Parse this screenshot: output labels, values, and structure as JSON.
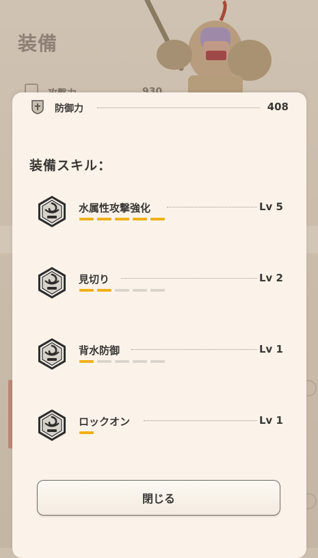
{
  "background": {
    "title": "装備",
    "stat_label": "攻撃力",
    "stat_value": "930"
  },
  "modal": {
    "defense": {
      "label": "防御力",
      "value": "408",
      "icon": "shield-icon"
    },
    "skills_heading": "装備スキル：",
    "skills": [
      {
        "name": "水属性攻撃強化",
        "level_label": "Lv 5",
        "level": 5,
        "max_level": 5,
        "icon": "skill-emblem-icon"
      },
      {
        "name": "見切り",
        "level_label": "Lv 2",
        "level": 2,
        "max_level": 5,
        "icon": "skill-emblem-icon"
      },
      {
        "name": "背水防御",
        "level_label": "Lv 1",
        "level": 1,
        "max_level": 5,
        "icon": "skill-emblem-icon"
      },
      {
        "name": "ロックオン",
        "level_label": "Lv 1",
        "level": 1,
        "max_level": 1,
        "icon": "skill-emblem-icon"
      }
    ],
    "close_label": "閉じる"
  },
  "colors": {
    "level_on": "#f0b018",
    "level_off": "#d9d4cc",
    "modal_bg": "#fbf3ea",
    "text": "#3a3734"
  }
}
